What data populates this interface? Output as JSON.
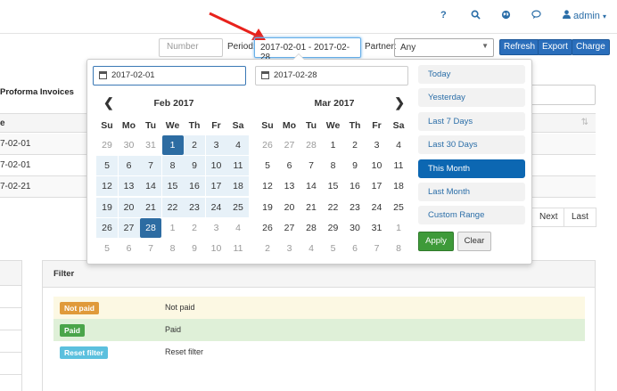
{
  "topbar": {
    "help_icon": "?",
    "search_icon": "search",
    "globe_icon": "globe",
    "chat_icon": "chat",
    "user_label": "admin"
  },
  "toolbar": {
    "number_placeholder": "Number",
    "period_label": "Period:",
    "period_value": "2017-02-01 - 2017-02-28",
    "partner_label": "Partner:",
    "partner_value": "Any",
    "refresh_label": "Refresh",
    "export_label": "Export",
    "charge_label": "Charge"
  },
  "background": {
    "section_title": "Proforma Invoices",
    "column_header": "e",
    "rows": [
      "7-02-01",
      "7-02-01",
      "7-02-21"
    ],
    "pager_next": "Next",
    "pager_last": "Last"
  },
  "filter": {
    "title": "Filter",
    "items": [
      {
        "badge": "Not paid",
        "text": "Not paid",
        "badge_color": "#e09a3a",
        "row_color": "#fcf8e3"
      },
      {
        "badge": "Paid",
        "text": "Paid",
        "badge_color": "#4aa54a",
        "row_color": "#dff0d8"
      },
      {
        "badge": "Reset filter",
        "text": "Reset filter",
        "badge_color": "#5bc0de",
        "row_color": "#ffffff"
      }
    ]
  },
  "picker": {
    "start_input": "2017-02-01",
    "end_input": "2017-02-28",
    "prev_arrow": "❮",
    "next_arrow": "❯",
    "dow": [
      "Su",
      "Mo",
      "Tu",
      "We",
      "Th",
      "Fr",
      "Sa"
    ],
    "left_month": "Feb 2017",
    "right_month": "Mar 2017",
    "left_days": [
      [
        "29",
        "30",
        "31",
        "1",
        "2",
        "3",
        "4"
      ],
      [
        "5",
        "6",
        "7",
        "8",
        "9",
        "10",
        "11"
      ],
      [
        "12",
        "13",
        "14",
        "15",
        "16",
        "17",
        "18"
      ],
      [
        "19",
        "20",
        "21",
        "22",
        "23",
        "24",
        "25"
      ],
      [
        "26",
        "27",
        "28",
        "1",
        "2",
        "3",
        "4"
      ],
      [
        "5",
        "6",
        "7",
        "8",
        "9",
        "10",
        "11"
      ]
    ],
    "right_days": [
      [
        "26",
        "27",
        "28",
        "1",
        "2",
        "3",
        "4"
      ],
      [
        "5",
        "6",
        "7",
        "8",
        "9",
        "10",
        "11"
      ],
      [
        "12",
        "13",
        "14",
        "15",
        "16",
        "17",
        "18"
      ],
      [
        "19",
        "20",
        "21",
        "22",
        "23",
        "24",
        "25"
      ],
      [
        "26",
        "27",
        "28",
        "29",
        "30",
        "31",
        "1"
      ],
      [
        "2",
        "3",
        "4",
        "5",
        "6",
        "7",
        "8"
      ]
    ],
    "ranges": [
      "Today",
      "Yesterday",
      "Last 7 Days",
      "Last 30 Days",
      "This Month",
      "Last Month",
      "Custom Range"
    ],
    "active_range": "This Month",
    "apply_label": "Apply",
    "clear_label": "Clear"
  },
  "colors": {
    "accent": "#2a6ebb",
    "range_selected": "#2d6ca2",
    "range_fill": "#e7f1f8",
    "apply": "#3e9a39",
    "arrow": "#e8221c"
  }
}
